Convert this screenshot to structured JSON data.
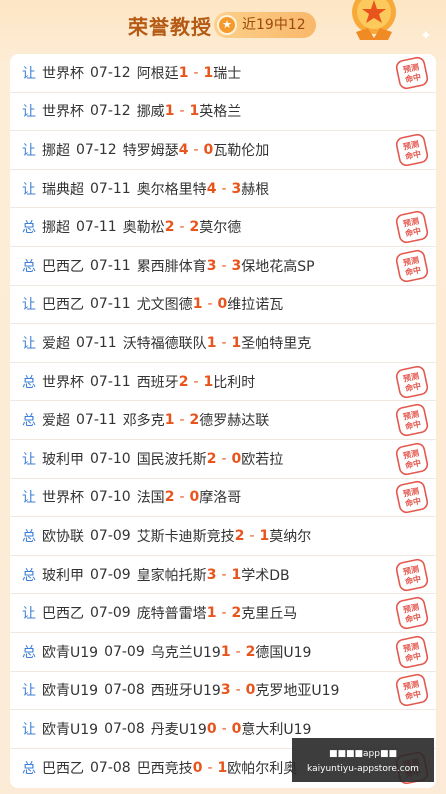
{
  "header": {
    "title": "荣誉教授",
    "badge_text": "近19中12",
    "badge_icon": "medal-icon"
  },
  "colors": {
    "tag": "#3d7ed9",
    "score": "#e8541b",
    "title": "#b45a14",
    "stamp": "#e4584e"
  },
  "stamp_text": "预测命中",
  "rows": [
    {
      "tag": "让",
      "league": "世界杯",
      "date": "07-12",
      "home": "阿根廷",
      "hs": "1",
      "as": "1",
      "away": "瑞士",
      "hit": true
    },
    {
      "tag": "让",
      "league": "世界杯",
      "date": "07-12",
      "home": "挪威",
      "hs": "1",
      "as": "1",
      "away": "英格兰",
      "hit": false
    },
    {
      "tag": "让",
      "league": "挪超",
      "date": "07-12",
      "home": "特罗姆瑟",
      "hs": "4",
      "as": "0",
      "away": "瓦勒伦加",
      "hit": true
    },
    {
      "tag": "让",
      "league": "瑞典超",
      "date": "07-11",
      "home": "奥尔格里特",
      "hs": "4",
      "as": "3",
      "away": "赫根",
      "hit": false
    },
    {
      "tag": "总",
      "league": "挪超",
      "date": "07-11",
      "home": "奥勒松",
      "hs": "2",
      "as": "2",
      "away": "莫尔德",
      "hit": true
    },
    {
      "tag": "总",
      "league": "巴西乙",
      "date": "07-11",
      "home": "累西腓体育",
      "hs": "3",
      "as": "3",
      "away": "保地花高SP",
      "hit": true
    },
    {
      "tag": "让",
      "league": "巴西乙",
      "date": "07-11",
      "home": "尤文图德",
      "hs": "1",
      "as": "0",
      "away": "维拉诺瓦",
      "hit": false
    },
    {
      "tag": "让",
      "league": "爱超",
      "date": "07-11",
      "home": "沃特福德联队",
      "hs": "1",
      "as": "1",
      "away": "圣帕特里克",
      "hit": false
    },
    {
      "tag": "总",
      "league": "世界杯",
      "date": "07-11",
      "home": "西班牙",
      "hs": "2",
      "as": "1",
      "away": "比利时",
      "hit": true
    },
    {
      "tag": "总",
      "league": "爱超",
      "date": "07-11",
      "home": "邓多克",
      "hs": "1",
      "as": "2",
      "away": "德罗赫达联",
      "hit": true
    },
    {
      "tag": "让",
      "league": "玻利甲",
      "date": "07-10",
      "home": "国民波托斯",
      "hs": "2",
      "as": "0",
      "away": "欧若拉",
      "hit": true
    },
    {
      "tag": "让",
      "league": "世界杯",
      "date": "07-10",
      "home": "法国",
      "hs": "2",
      "as": "0",
      "away": "摩洛哥",
      "hit": true
    },
    {
      "tag": "总",
      "league": "欧协联",
      "date": "07-09",
      "home": "艾斯卡迪斯竞技",
      "hs": "2",
      "as": "1",
      "away": "莫纳尔",
      "hit": false
    },
    {
      "tag": "总",
      "league": "玻利甲",
      "date": "07-09",
      "home": "皇家帕托斯",
      "hs": "3",
      "as": "1",
      "away": "学术DB",
      "hit": true
    },
    {
      "tag": "让",
      "league": "巴西乙",
      "date": "07-09",
      "home": "庞特普雷塔",
      "hs": "1",
      "as": "2",
      "away": "克里丘马",
      "hit": true
    },
    {
      "tag": "总",
      "league": "欧青U19",
      "date": "07-09",
      "home": "乌克兰U19",
      "hs": "1",
      "as": "2",
      "away": "德国U19",
      "hit": true
    },
    {
      "tag": "让",
      "league": "欧青U19",
      "date": "07-08",
      "home": "西班牙U19",
      "hs": "3",
      "as": "0",
      "away": "克罗地亚U19",
      "hit": true
    },
    {
      "tag": "让",
      "league": "欧青U19",
      "date": "07-08",
      "home": "丹麦U19",
      "hs": "0",
      "as": "0",
      "away": "意大利U19",
      "hit": false
    },
    {
      "tag": "总",
      "league": "巴西乙",
      "date": "07-08",
      "home": "巴西竞技",
      "hs": "0",
      "as": "1",
      "away": "欧帕尔利奥",
      "hit": true
    }
  ],
  "watermark": {
    "line1": "■■■■app■■",
    "line2": "kaiyuntiyu-appstore.com"
  }
}
